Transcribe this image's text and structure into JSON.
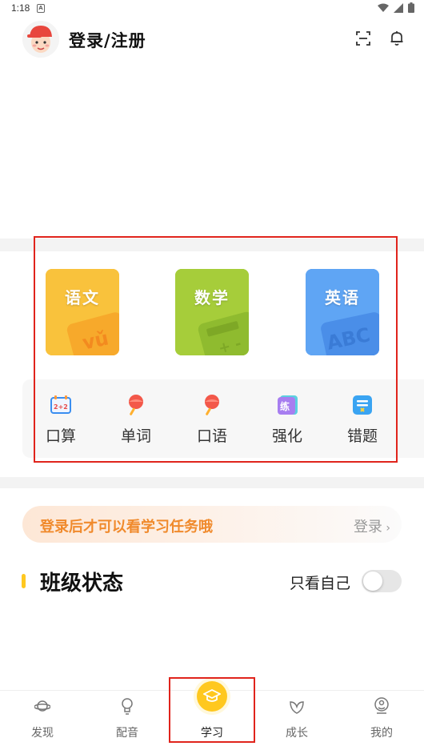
{
  "status_bar": {
    "time": "1:18",
    "notif_letter": "A"
  },
  "header": {
    "login_title": "登录/注册"
  },
  "subjects": [
    {
      "label": "语文",
      "color": "#f9c23c"
    },
    {
      "label": "数学",
      "color": "#a6cd3a"
    },
    {
      "label": "英语",
      "color": "#5fa5f4"
    }
  ],
  "tools": [
    {
      "label": "口算",
      "icon": "calculator-board-icon"
    },
    {
      "label": "单词",
      "icon": "bamboo-dragonfly-icon"
    },
    {
      "label": "口语",
      "icon": "bamboo-dragonfly-icon"
    },
    {
      "label": "强化",
      "icon": "practice-icon",
      "icon_text": "练"
    },
    {
      "label": "错题",
      "icon": "wrong-questions-icon"
    }
  ],
  "login_notice": {
    "message": "登录后才可以看学习任务哦",
    "action": "登录"
  },
  "class_section": {
    "title": "班级状态",
    "filter_label": "只看自己",
    "toggle_on": false
  },
  "tabbar": [
    {
      "label": "发现",
      "icon": "planet-icon"
    },
    {
      "label": "配音",
      "icon": "bulb-icon"
    },
    {
      "label": "学习",
      "icon": "graduation-cap-icon",
      "active": true
    },
    {
      "label": "成长",
      "icon": "leaf-icon"
    },
    {
      "label": "我的",
      "icon": "user-icon"
    }
  ],
  "colors": {
    "accent": "#ffc820",
    "notice_text": "#f08a2c",
    "highlight_box": "#e0241c"
  }
}
